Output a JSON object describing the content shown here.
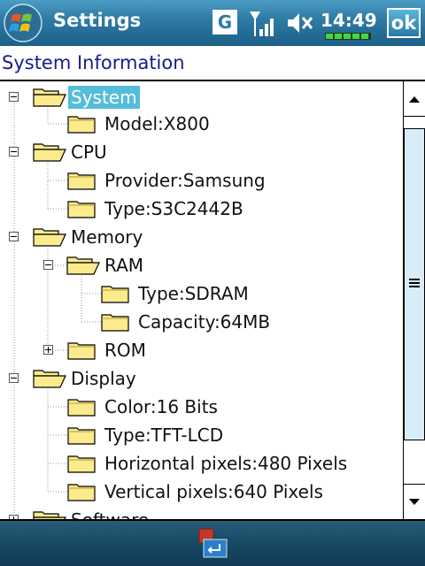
{
  "titlebar": {
    "title": "Settings",
    "network_badge": "G",
    "time": "14:49",
    "ok_label": "ok"
  },
  "page": {
    "title": "System Information"
  },
  "tree": {
    "system": "System",
    "model": "Model:X800",
    "cpu": "CPU",
    "provider": "Provider:Samsung",
    "cpu_type": "Type:S3C2442B",
    "memory": "Memory",
    "ram": "RAM",
    "ram_type": "Type:SDRAM",
    "ram_capacity": "Capacity:64MB",
    "rom": "ROM",
    "display": "Display",
    "color": "Color:16 Bits",
    "display_type": "Type:TFT-LCD",
    "horizontal": "Horizontal pixels:480 Pixels",
    "vertical": "Vertical pixels:640 Pixels",
    "software": "Software"
  },
  "colors": {
    "selection": "#55bdd9",
    "title_text": "#1a1a8f",
    "folder_fill": "#fbeb8d"
  }
}
